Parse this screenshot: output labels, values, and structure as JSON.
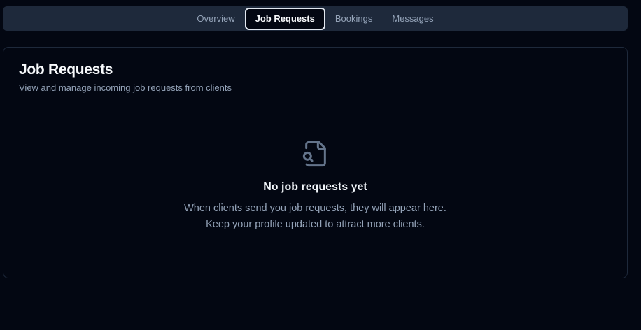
{
  "tabs": [
    {
      "label": "Overview",
      "active": false
    },
    {
      "label": "Job Requests",
      "active": true
    },
    {
      "label": "Bookings",
      "active": false
    },
    {
      "label": "Messages",
      "active": false
    }
  ],
  "card": {
    "title": "Job Requests",
    "subtitle": "View and manage incoming job requests from clients"
  },
  "empty_state": {
    "icon": "file-search-icon",
    "title": "No job requests yet",
    "line1": "When clients send you job requests, they will appear here.",
    "line2": "Keep your profile updated to attract more clients."
  },
  "colors": {
    "background": "#030712",
    "tab_bar": "#1e293b",
    "text_primary": "#f8fafc",
    "text_muted": "#94a3b8",
    "border": "#1e293b"
  }
}
